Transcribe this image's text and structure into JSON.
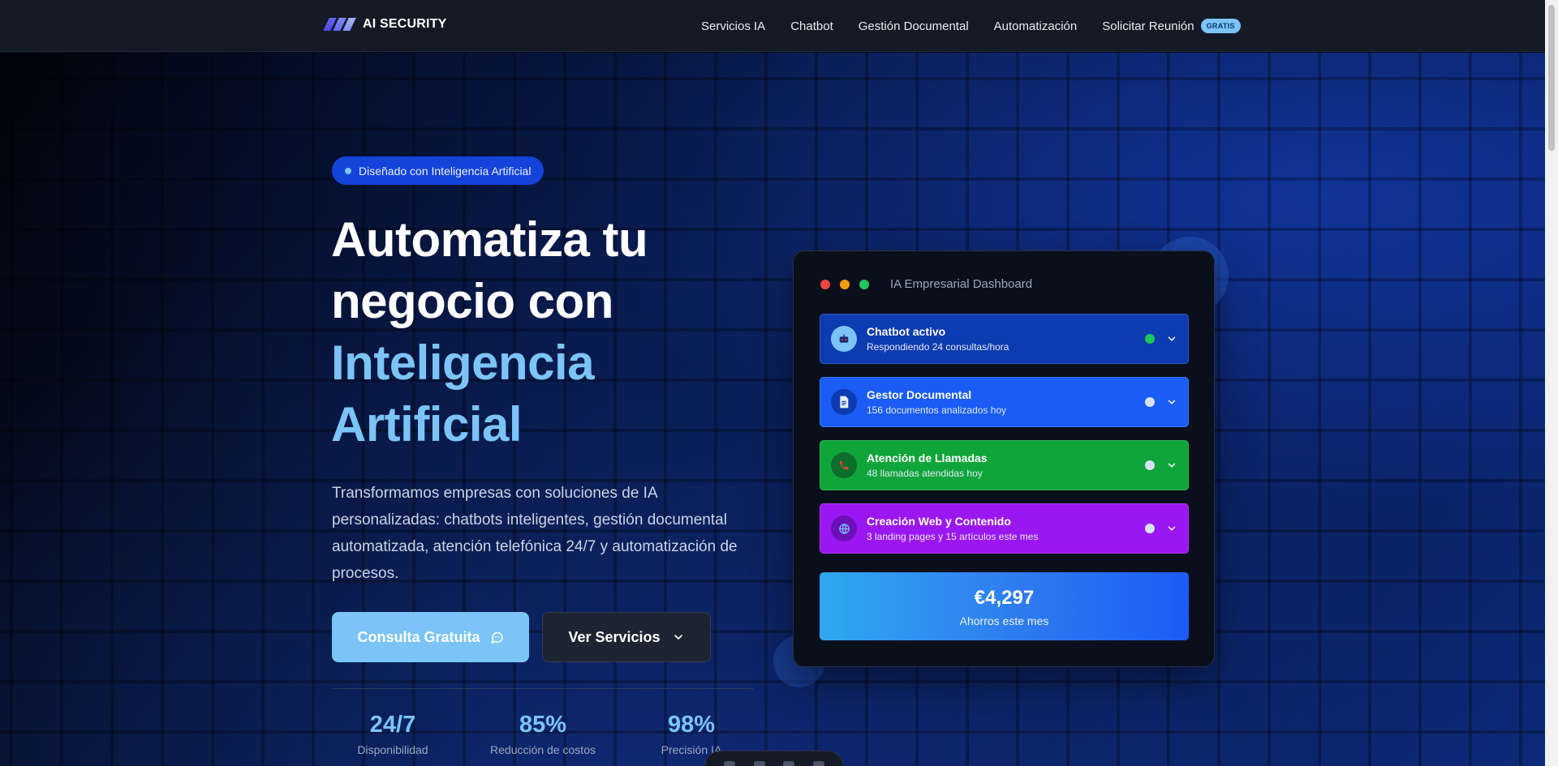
{
  "nav": {
    "logo_text": "AI SECURITY",
    "links": [
      "Servicios IA",
      "Chatbot",
      "Gestión Documental",
      "Automatización",
      "Solicitar Reunión"
    ],
    "badge": "GRATIS"
  },
  "hero": {
    "pill": "Diseñado con Inteligencia Artificial",
    "headline_line1": "Automatiza tu",
    "headline_line2": "negocio con",
    "headline_accent1": "Inteligencia",
    "headline_accent2": "Artificial",
    "subtext": "Transformamos empresas con soluciones de IA personalizadas: chatbots inteligentes, gestión documental automatizada, atención telefónica 24/7 y automatización de procesos.",
    "primary_button": "Consulta Gratuita",
    "secondary_button": "Ver Servicios",
    "stats": [
      {
        "value": "24/7",
        "label": "Disponibilidad"
      },
      {
        "value": "85%",
        "label": "Reducción de costos"
      },
      {
        "value": "98%",
        "label": "Precisión IA"
      }
    ]
  },
  "dashboard": {
    "title": "IA Empresarial Dashboard",
    "cards": [
      {
        "title": "Chatbot activo",
        "sub": "Respondiendo 24 consultas/hora",
        "bg": "#0d3bb0",
        "icon_bg": "#7cc4f7",
        "dot": "#22c55e",
        "icon": "robot-icon"
      },
      {
        "title": "Gestor Documental",
        "sub": "156 documentos analizados hoy",
        "bg": "#1a5cf5",
        "icon_bg": "#0d3bb0",
        "dot": "#d8e2f5",
        "icon": "document-icon"
      },
      {
        "title": "Atención de Llamadas",
        "sub": "48 llamadas atendidas hoy",
        "bg": "#10a53a",
        "icon_bg": "#0b6e2a",
        "dot": "#d8e2f5",
        "icon": "phone-icon"
      },
      {
        "title": "Creación Web y Contenido",
        "sub": "3 landing pages y 15 artículos este mes",
        "bg": "#9b17f2",
        "icon_bg": "#6b10b8",
        "dot": "#d8e2f5",
        "icon": "globe-icon"
      }
    ],
    "savings_value": "€4,297",
    "savings_label": "Ahorros este mes"
  },
  "colors": {
    "accent": "#7cc4f7",
    "primary_blue": "#1a5cf5"
  }
}
